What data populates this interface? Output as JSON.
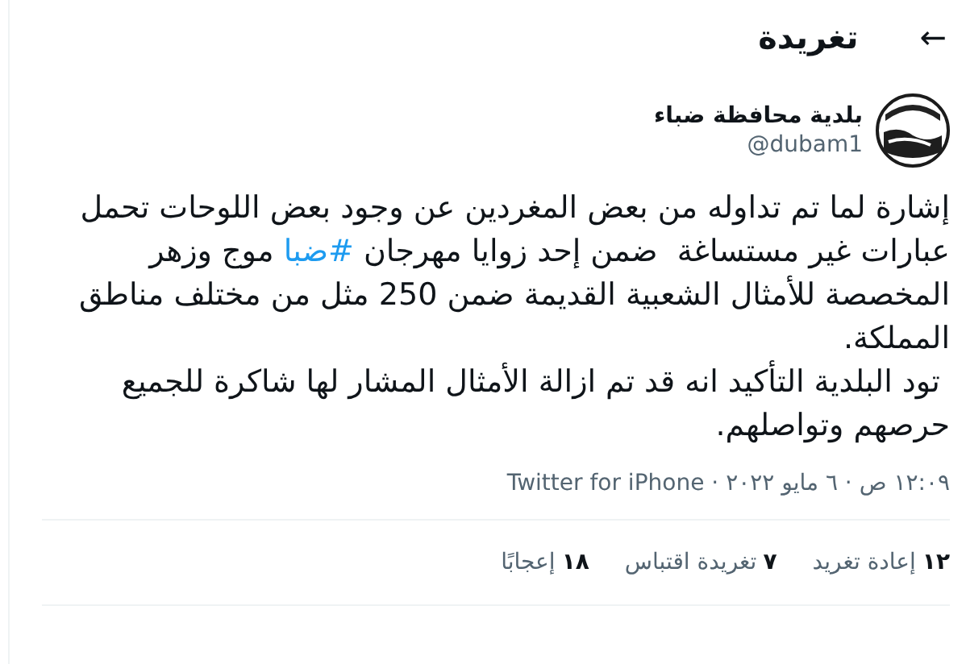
{
  "header": {
    "title": "تغريدة",
    "back": "←"
  },
  "author": {
    "name": "بلدية محافظة ضباء",
    "handle": "@dubam1"
  },
  "tweet": {
    "paragraphs": [
      {
        "before": "إشارة لما تم تداوله من بعض المغردين عن وجود بعض اللوحات تحمل عبارات غير مستساغة  ضمن إحد زوايا مهرجان ",
        "hashtag": "#ضبا",
        "after": " موج وزهر المخصصة للأمثال الشعبية القديمة ضمن 250 مثل من مختلف مناطق المملكة."
      },
      {
        "before": " تود البلدية التأكيد انه قد تم ازالة الأمثال المشار لها شاكرة للجميع حرصهم وتواصلهم."
      }
    ]
  },
  "meta": {
    "time": "١٢:٠٩ ص · ٦ مايو ٢٠٢٢ · ",
    "source": "Twitter for iPhone"
  },
  "stats": [
    {
      "count": "١٢",
      "label": "إعادة تغريد"
    },
    {
      "count": "٧",
      "label": "تغريدة اقتباس"
    },
    {
      "count": "١٨",
      "label": "إعجابًا"
    }
  ]
}
